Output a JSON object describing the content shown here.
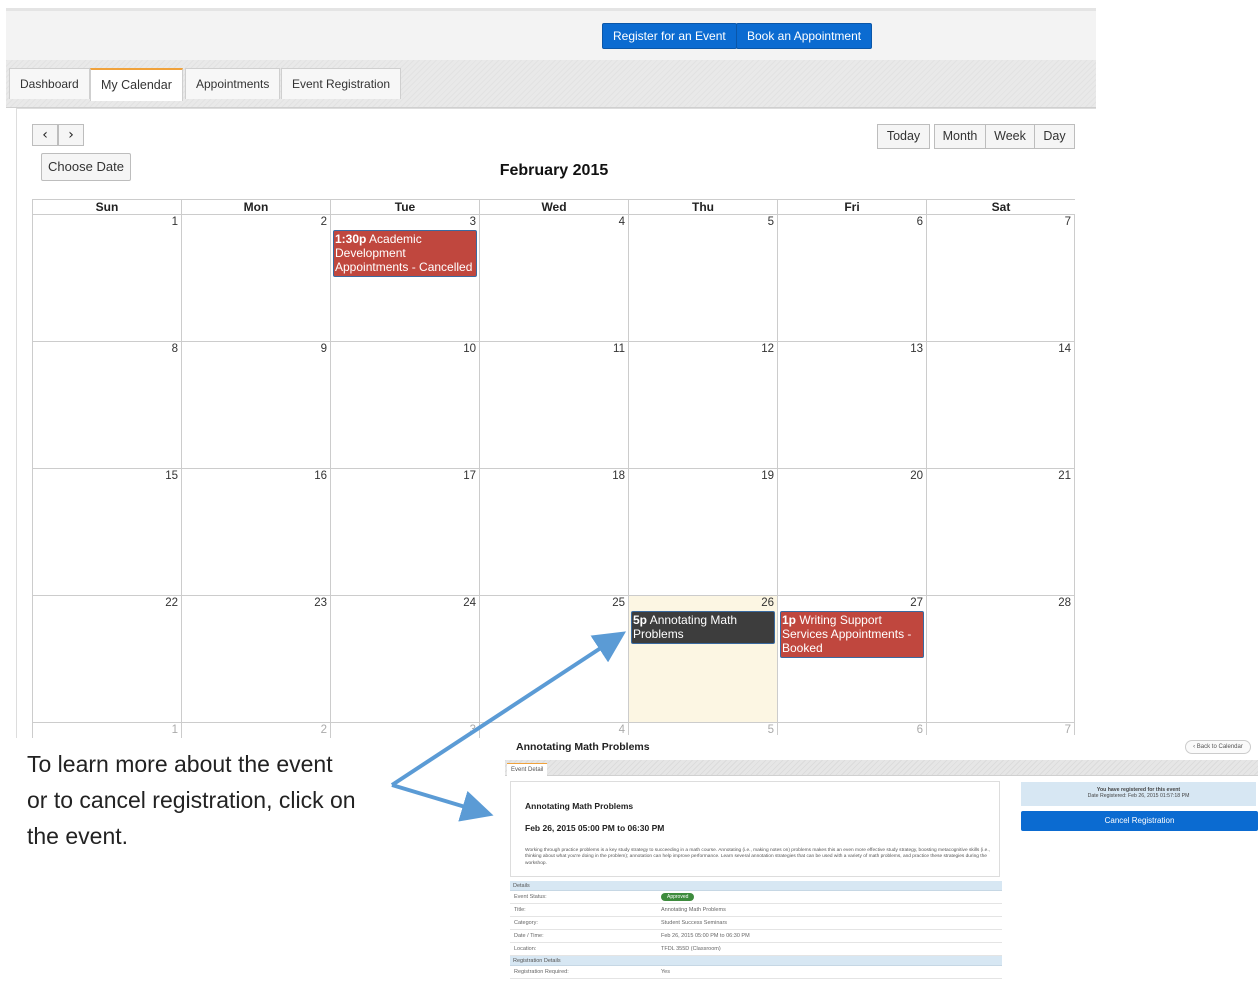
{
  "header": {
    "register_button": "Register for an Event",
    "book_button": "Book an Appointment"
  },
  "tabs": [
    {
      "label": "Dashboard"
    },
    {
      "label": "My Calendar",
      "active": true
    },
    {
      "label": "Appointments"
    },
    {
      "label": "Event Registration"
    }
  ],
  "calendar": {
    "prev_icon": "chevron-left-icon",
    "next_icon": "chevron-right-icon",
    "prev_glyph": "‹",
    "next_glyph": "›",
    "choose_date": "Choose Date",
    "title": "February 2015",
    "views": {
      "today": "Today",
      "month": "Month",
      "week": "Week",
      "day": "Day"
    },
    "days_of_week": [
      "Sun",
      "Mon",
      "Tue",
      "Wed",
      "Thu",
      "Fri",
      "Sat"
    ],
    "weeks": [
      [
        "1",
        "2",
        "3",
        "4",
        "5",
        "6",
        "7"
      ],
      [
        "8",
        "9",
        "10",
        "11",
        "12",
        "13",
        "14"
      ],
      [
        "15",
        "16",
        "17",
        "18",
        "19",
        "20",
        "21"
      ],
      [
        "22",
        "23",
        "24",
        "25",
        "26",
        "27",
        "28"
      ],
      [
        "1",
        "2",
        "3",
        "4",
        "5",
        "6",
        "7"
      ]
    ],
    "today_date": "26",
    "events": [
      {
        "date": "3",
        "time": "1:30p",
        "title": "Academic Development Appointments - Cancelled",
        "color": "#c0473e"
      },
      {
        "date": "26",
        "time": "5p",
        "title": "Annotating Math Problems",
        "color": "#3d3d3d"
      },
      {
        "date": "27",
        "time": "1p",
        "title": "Writing Support Services Appointments - Booked",
        "color": "#c0473e"
      }
    ]
  },
  "instruction": "To learn more about the event or to cancel registration, click on the event.",
  "detail": {
    "page_title": "Annotating Math Problems",
    "back_button": "‹ Back to Calendar",
    "tab": "Event Detail",
    "heading": "Annotating Math Problems",
    "datetime": "Feb 26, 2015 05:00 PM to 06:30 PM",
    "description": "Working through practice problems is a key study strategy to succeeding in a math course. Annotating (i.e., making notes on) problems makes this an even more effective study strategy, boosting metacognitive skills (i.e., thinking about what you're doing in the problem); annotation can help improve performance. Learn several annotation strategies that can be used with a variety of math problems, and practice these strategies during the workshop.",
    "details_section": "Details",
    "rows": [
      {
        "label": "Event Status:",
        "value": "Approved",
        "badge": true
      },
      {
        "label": "Title:",
        "value": "Annotating Math Problems"
      },
      {
        "label": "Category:",
        "value": "Student Success Seminars"
      },
      {
        "label": "Date / Time:",
        "value": "Feb 26, 2015 05:00 PM to 06:30 PM"
      },
      {
        "label": "Location:",
        "value": "TFDL 355D (Classroom)"
      }
    ],
    "registration_section": "Registration Details",
    "registration_rows": [
      {
        "label": "Registration Required:",
        "value": "Yes"
      }
    ],
    "registered_line1": "You have registered for this event",
    "registered_line2": "Date Registered: Feb 26, 2015 01:57:18 PM",
    "cancel_button": "Cancel Registration"
  }
}
